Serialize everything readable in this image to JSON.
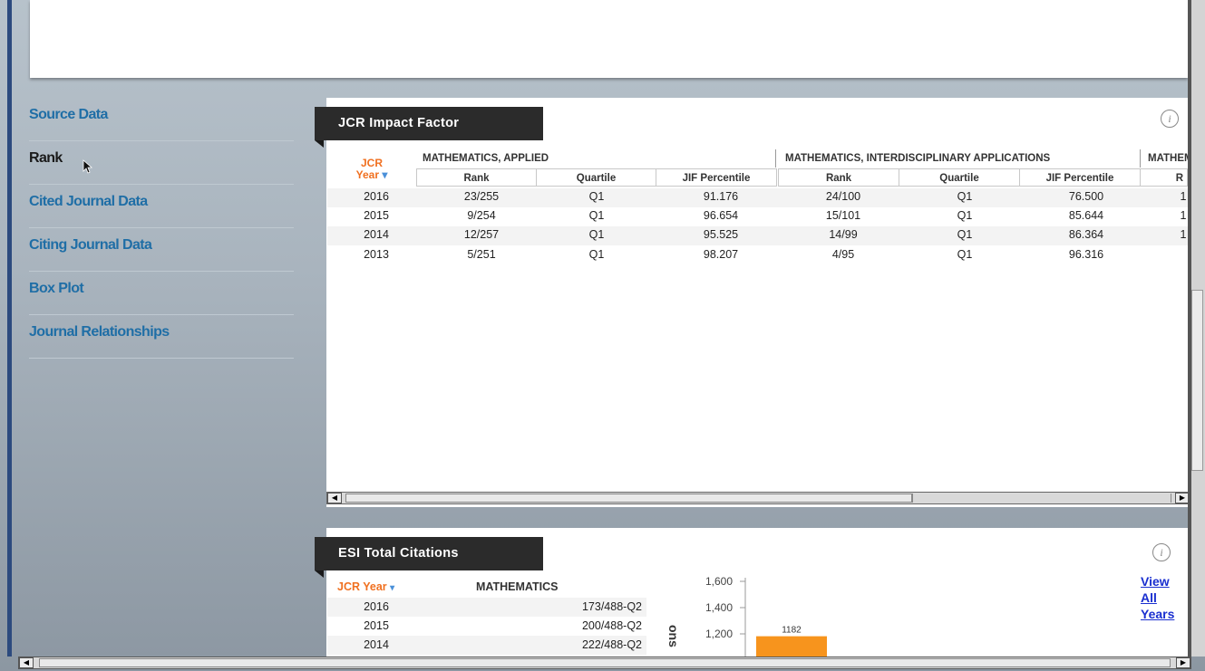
{
  "sidebar": {
    "items": [
      {
        "label": "Source Data",
        "active": false
      },
      {
        "label": "Rank",
        "active": true
      },
      {
        "label": "Cited Journal Data",
        "active": false
      },
      {
        "label": "Citing Journal Data",
        "active": false
      },
      {
        "label": "Box Plot",
        "active": false
      },
      {
        "label": "Journal Relationships",
        "active": false
      }
    ]
  },
  "jcr_panel": {
    "title": "JCR Impact Factor",
    "info_icon": "i",
    "year_header_line1": "JCR",
    "year_header_line2": "Year",
    "sort_icon": "▾",
    "groups": [
      "MATHEMATICS, APPLIED",
      "MATHEMATICS, INTERDISCIPLINARY APPLICATIONS",
      "MATHEMATICS"
    ],
    "sub_headers": [
      "Rank",
      "Quartile",
      "JIF Percentile",
      "Rank",
      "Quartile",
      "JIF Percentile",
      "R"
    ],
    "rows": [
      {
        "year": "2016",
        "g1_rank": "23/255",
        "g1_q": "Q1",
        "g1_pct": "91.176",
        "g2_rank": "24/100",
        "g2_q": "Q1",
        "g2_pct": "76.500",
        "g3": "1"
      },
      {
        "year": "2015",
        "g1_rank": "9/254",
        "g1_q": "Q1",
        "g1_pct": "96.654",
        "g2_rank": "15/101",
        "g2_q": "Q1",
        "g2_pct": "85.644",
        "g3": "1"
      },
      {
        "year": "2014",
        "g1_rank": "12/257",
        "g1_q": "Q1",
        "g1_pct": "95.525",
        "g2_rank": "14/99",
        "g2_q": "Q1",
        "g2_pct": "86.364",
        "g3": "1"
      },
      {
        "year": "2013",
        "g1_rank": "5/251",
        "g1_q": "Q1",
        "g1_pct": "98.207",
        "g2_rank": "4/95",
        "g2_q": "Q1",
        "g2_pct": "96.316",
        "g3": ""
      }
    ]
  },
  "esi_panel": {
    "title": "ESI Total Citations",
    "info_icon": "i",
    "year_header": "JCR Year",
    "col_header": "MATHEMATICS",
    "rows": [
      {
        "year": "2016",
        "value": "173/488-Q2"
      },
      {
        "year": "2015",
        "value": "200/488-Q2"
      },
      {
        "year": "2014",
        "value": "222/488-Q2"
      }
    ],
    "view_all_link": [
      "View",
      "All",
      "Years"
    ]
  },
  "chart_data": {
    "type": "bar",
    "ylabel": "ons",
    "yticks": [
      "1,600",
      "1,400",
      "1,200"
    ],
    "bar_label": "1182",
    "values": [
      1182
    ],
    "bar_color": "#f7941d"
  }
}
